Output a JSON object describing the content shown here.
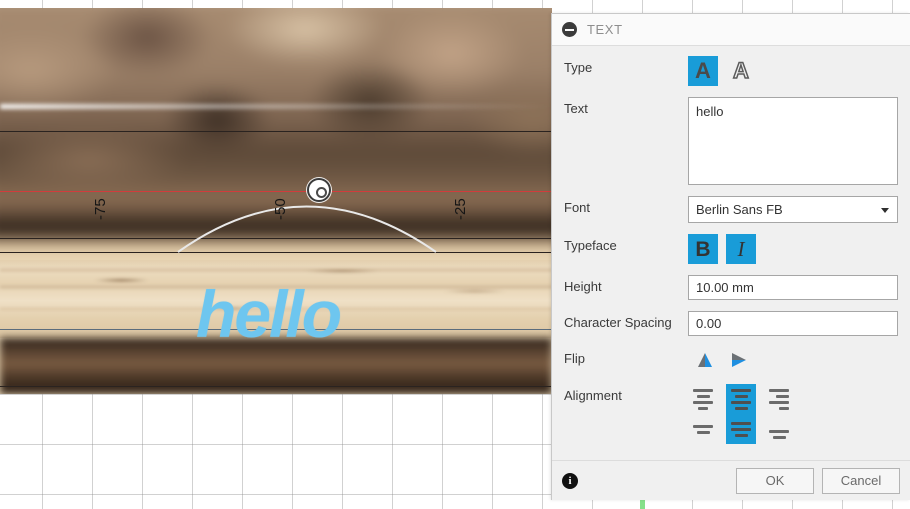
{
  "panel": {
    "title": "TEXT",
    "collapse_icon": "minus-circle-icon",
    "rows": {
      "type": {
        "label": "Type",
        "options": [
          {
            "icon": "solid-letter-a-icon",
            "glyph": "A",
            "selected": true
          },
          {
            "icon": "outline-letter-a-icon",
            "glyph": "A",
            "selected": false
          }
        ]
      },
      "text": {
        "label": "Text",
        "value": "hello",
        "placeholder": ""
      },
      "font": {
        "label": "Font",
        "value": "Berlin Sans FB",
        "caret_icon": "chevron-down-icon"
      },
      "typeface": {
        "label": "Typeface",
        "options": [
          {
            "icon": "bold-icon",
            "glyph": "B",
            "selected": true
          },
          {
            "icon": "italic-icon",
            "glyph": "I",
            "selected": true
          }
        ]
      },
      "height": {
        "label": "Height",
        "value": "10.00 mm",
        "placeholder": ""
      },
      "character_spacing": {
        "label": "Character Spacing",
        "value": "0.00",
        "placeholder": ""
      },
      "flip": {
        "label": "Flip",
        "options": [
          {
            "icon": "flip-vertical-icon",
            "selected": false
          },
          {
            "icon": "flip-horizontal-icon",
            "selected": false
          }
        ]
      },
      "alignment": {
        "label": "Alignment",
        "row1": [
          {
            "icon": "align-left-icon",
            "selected": false
          },
          {
            "icon": "align-center-icon",
            "selected": true
          },
          {
            "icon": "align-right-icon",
            "selected": false
          }
        ],
        "row2": [
          {
            "icon": "align-top-icon",
            "selected": false
          },
          {
            "icon": "align-middle-icon",
            "selected": true
          },
          {
            "icon": "align-bottom-icon",
            "selected": false
          }
        ]
      }
    },
    "footer": {
      "info_icon": "info-icon",
      "info_glyph": "i",
      "ok_label": "OK",
      "cancel_label": "Cancel"
    }
  },
  "canvas": {
    "artwork_text": "hello",
    "artwork_text_color": "#6ec6ef",
    "ruler_ticks": [
      "-75",
      "-50",
      "-25"
    ],
    "guide_color": "#e0353a",
    "handle_icon": "rotation-handle-icon"
  },
  "colors": {
    "accent": "#199cd8",
    "panel_bg": "#f0f0f0",
    "text_blue": "#6ec6ef",
    "guide_red": "#e0353a",
    "green_tick": "#86e08a"
  }
}
